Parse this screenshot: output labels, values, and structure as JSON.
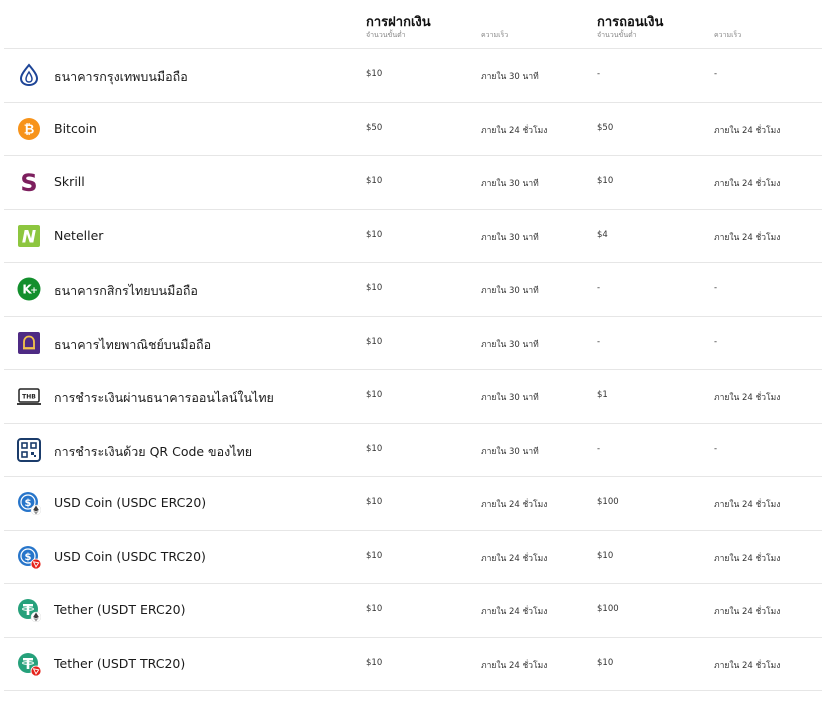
{
  "header": {
    "deposit_title": "การฝากเงิน",
    "withdraw_title": "การถอนเงิน",
    "min_label": "จำนวนขั้นต่ำ",
    "speed_label": "ความเร็ว"
  },
  "methods": [
    {
      "name": "ธนาคารกรุงเทพบนมือถือ",
      "icon": "bangkok-bank-icon",
      "dep_min": "$10",
      "dep_speed": "ภายใน 30 นาที",
      "wd_min": "-",
      "wd_speed": "-"
    },
    {
      "name": "Bitcoin",
      "icon": "bitcoin-icon",
      "dep_min": "$50",
      "dep_speed": "ภายใน 24 ชั่วโมง",
      "wd_min": "$50",
      "wd_speed": "ภายใน 24 ชั่วโมง"
    },
    {
      "name": "Skrill",
      "icon": "skrill-icon",
      "dep_min": "$10",
      "dep_speed": "ภายใน 30 นาที",
      "wd_min": "$10",
      "wd_speed": "ภายใน 24 ชั่วโมง"
    },
    {
      "name": "Neteller",
      "icon": "neteller-icon",
      "dep_min": "$10",
      "dep_speed": "ภายใน 30 นาที",
      "wd_min": "$4",
      "wd_speed": "ภายใน 24 ชั่วโมง"
    },
    {
      "name": "ธนาคารกสิกรไทยบนมือถือ",
      "icon": "kbank-icon",
      "dep_min": "$10",
      "dep_speed": "ภายใน 30 นาที",
      "wd_min": "-",
      "wd_speed": "-"
    },
    {
      "name": "ธนาคารไทยพาณิชย์บนมือถือ",
      "icon": "scb-icon",
      "dep_min": "$10",
      "dep_speed": "ภายใน 30 นาที",
      "wd_min": "-",
      "wd_speed": "-"
    },
    {
      "name": "การชำระเงินผ่านธนาคารออนไลน์ในไทย",
      "icon": "thb-card-icon",
      "dep_min": "$10",
      "dep_speed": "ภายใน 30 นาที",
      "wd_min": "$1",
      "wd_speed": "ภายใน 24 ชั่วโมง"
    },
    {
      "name": "การชำระเงินด้วย QR Code ของไทย",
      "icon": "qr-code-icon",
      "dep_min": "$10",
      "dep_speed": "ภายใน 30 นาที",
      "wd_min": "-",
      "wd_speed": "-"
    },
    {
      "name": "USD Coin (USDC ERC20)",
      "icon": "usdc-erc20-icon",
      "dep_min": "$10",
      "dep_speed": "ภายใน 24 ชั่วโมง",
      "wd_min": "$100",
      "wd_speed": "ภายใน 24 ชั่วโมง"
    },
    {
      "name": "USD Coin (USDC TRC20)",
      "icon": "usdc-trc20-icon",
      "dep_min": "$10",
      "dep_speed": "ภายใน 24 ชั่วโมง",
      "wd_min": "$10",
      "wd_speed": "ภายใน 24 ชั่วโมง"
    },
    {
      "name": "Tether (USDT ERC20)",
      "icon": "usdt-erc20-icon",
      "dep_min": "$10",
      "dep_speed": "ภายใน 24 ชั่วโมง",
      "wd_min": "$100",
      "wd_speed": "ภายใน 24 ชั่วโมง"
    },
    {
      "name": "Tether (USDT TRC20)",
      "icon": "usdt-trc20-icon",
      "dep_min": "$10",
      "dep_speed": "ภายใน 24 ชั่วโมง",
      "wd_min": "$10",
      "wd_speed": "ภายใน 24 ชั่วโมง"
    }
  ],
  "colors": {
    "bitcoin": "#F7931A",
    "skrill": "#7D1F5E",
    "neteller": "#8DC63F",
    "kbank": "#138F2D",
    "scb": "#4E2A84",
    "bangkok_bank": "#1E4597",
    "usdc": "#2775CA",
    "tether": "#26A17B",
    "tron": "#E5231B"
  }
}
